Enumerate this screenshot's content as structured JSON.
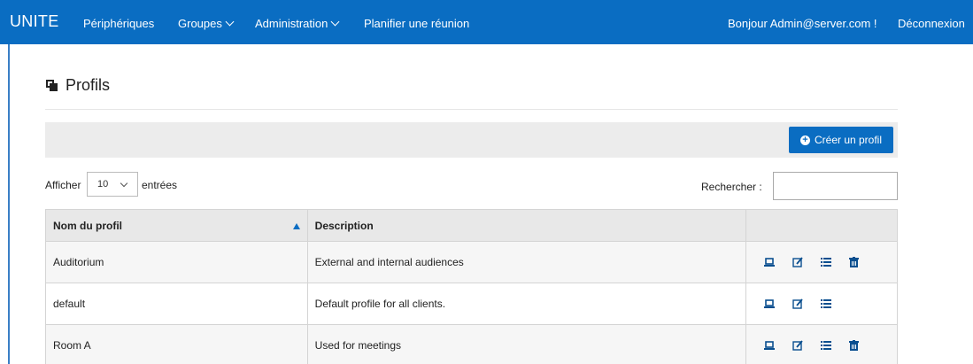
{
  "navbar": {
    "brand": "UNITE",
    "items": [
      {
        "label": "Périphériques",
        "dropdown": false
      },
      {
        "label": "Groupes",
        "dropdown": true
      },
      {
        "label": "Administration",
        "dropdown": true
      },
      {
        "label": "Planifier une réunion",
        "dropdown": false
      }
    ],
    "greeting": "Bonjour Admin@server.com !",
    "logout": "Déconnexion",
    "color": "#0a6dc2"
  },
  "page": {
    "title": "Profils",
    "title_icon": "clone-icon"
  },
  "toolbar": {
    "create_label": "Créer un profil",
    "create_icon": "plus-circle-icon"
  },
  "list_controls": {
    "show_label": "Afficher",
    "page_size": "10",
    "entries_label": "entrées",
    "search_label": "Rechercher :",
    "search_value": ""
  },
  "table": {
    "columns": [
      "Nom du profil",
      "Description",
      ""
    ],
    "sorted_column": "Nom du profil",
    "sort_direction": "asc",
    "rows": [
      {
        "name": "Auditorium",
        "description": "External and internal audiences",
        "actions": [
          "devices-icon",
          "edit-icon",
          "list-icon",
          "trash-icon"
        ]
      },
      {
        "name": "default",
        "description": "Default profile for all clients.",
        "actions": [
          "devices-icon",
          "edit-icon",
          "list-icon"
        ]
      },
      {
        "name": "Room A",
        "description": "Used for meetings",
        "actions": [
          "devices-icon",
          "edit-icon",
          "list-icon",
          "trash-icon"
        ]
      }
    ]
  }
}
